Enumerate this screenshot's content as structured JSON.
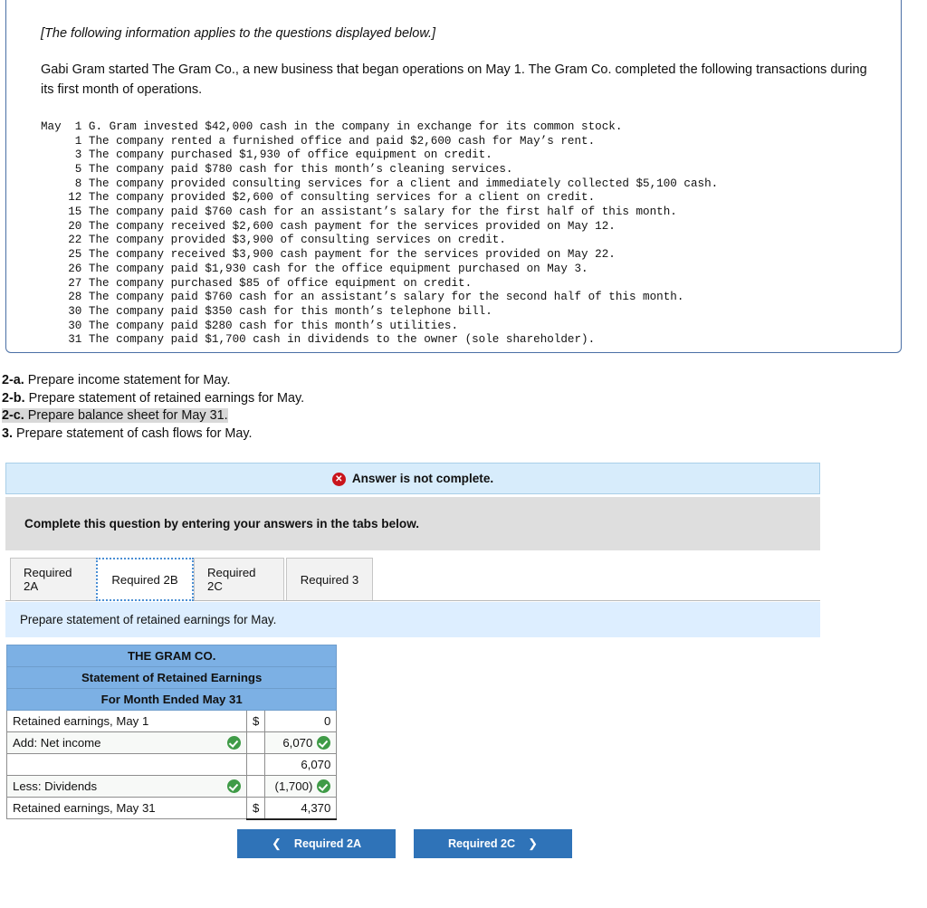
{
  "info_box": {
    "italic_note": "[The following information applies to the questions displayed below.]",
    "intro": "Gabi Gram started The Gram Co., a new business that began operations on May 1. The Gram Co. completed the following transactions during its first month of operations.",
    "transactions": "May  1 G. Gram invested $42,000 cash in the company in exchange for its common stock.\n     1 The company rented a furnished office and paid $2,600 cash for May’s rent.\n     3 The company purchased $1,930 of office equipment on credit.\n     5 The company paid $780 cash for this month’s cleaning services.\n     8 The company provided consulting services for a client and immediately collected $5,100 cash.\n    12 The company provided $2,600 of consulting services for a client on credit.\n    15 The company paid $760 cash for an assistant’s salary for the first half of this month.\n    20 The company received $2,600 cash payment for the services provided on May 12.\n    22 The company provided $3,900 of consulting services on credit.\n    25 The company received $3,900 cash payment for the services provided on May 22.\n    26 The company paid $1,930 cash for the office equipment purchased on May 3.\n    27 The company purchased $85 of office equipment on credit.\n    28 The company paid $760 cash for an assistant’s salary for the second half of this month.\n    30 The company paid $350 cash for this month’s telephone bill.\n    30 The company paid $280 cash for this month’s utilities.\n    31 The company paid $1,700 cash in dividends to the owner (sole shareholder)."
  },
  "requirements": [
    {
      "num": "2-a.",
      "text": " Prepare income statement for May.",
      "highlighted": false
    },
    {
      "num": "2-b.",
      "text": " Prepare statement of retained earnings for May.",
      "highlighted": false
    },
    {
      "num": "2-c.",
      "text": " Prepare balance sheet for May 31.",
      "highlighted": true
    },
    {
      "num": "3.",
      "text": " Prepare statement of cash flows for May.",
      "highlighted": false
    }
  ],
  "alerts": {
    "error_text": "Answer is not complete.",
    "error_icon": "error-circle-x-icon",
    "instruction_text": "Complete this question by entering your answers in the tabs below."
  },
  "tabs": {
    "items": [
      {
        "label": "Required 2A",
        "active": false
      },
      {
        "label": "Required 2B",
        "active": true
      },
      {
        "label": "Required 2C",
        "active": false
      },
      {
        "label": "Required 3",
        "active": false
      }
    ],
    "description": "Prepare statement of retained earnings for May."
  },
  "statement": {
    "header_rows": [
      "THE GRAM CO.",
      "Statement of Retained Earnings",
      "For Month Ended May 31"
    ],
    "rows": [
      {
        "label": "Retained earnings, May 1",
        "label_check": false,
        "dollar": "$",
        "amount": "0",
        "amount_check": false,
        "topline": false
      },
      {
        "label": "Add: Net income",
        "label_check": true,
        "dollar": "",
        "amount": "6,070",
        "amount_check": true,
        "topline": false
      },
      {
        "label": "",
        "label_check": false,
        "dollar": "",
        "amount": "6,070",
        "amount_check": false,
        "topline": true
      },
      {
        "label": "Less: Dividends",
        "label_check": true,
        "dollar": "",
        "amount": "(1,700)",
        "amount_check": true,
        "topline": false
      },
      {
        "label": "Retained earnings, May 31",
        "label_check": false,
        "dollar": "$",
        "amount": "4,370",
        "amount_check": false,
        "topline": false
      }
    ]
  },
  "nav": {
    "prev_label": "Required 2A",
    "prev_icon": "chevron-left-icon",
    "next_label": "Required 2C",
    "next_icon": "chevron-right-icon"
  },
  "colors": {
    "header_blue": "#7cb0e4",
    "alert_blue": "#d7ecfb",
    "alert_gray": "#dedede",
    "tab_desc_blue": "#ddeeff",
    "button_blue": "#2f73b8",
    "check_green": "#3f9b47",
    "error_red": "#c9141b"
  }
}
